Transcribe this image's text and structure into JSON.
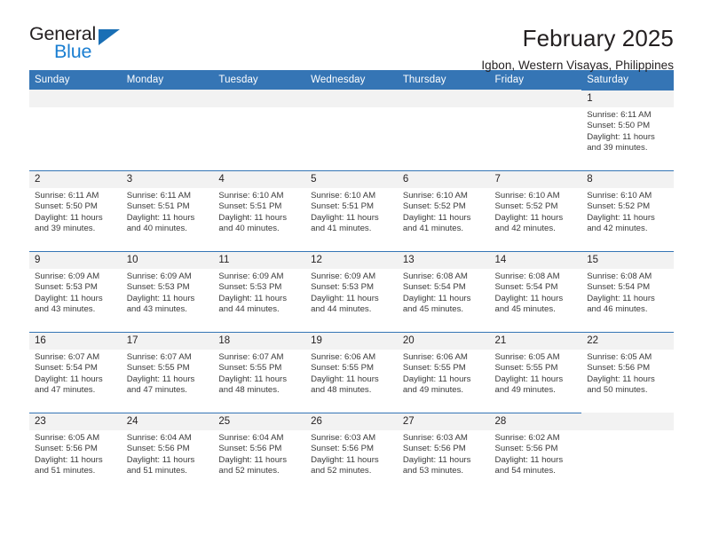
{
  "brand": {
    "name_top": "General",
    "name_bottom": "Blue",
    "accent_color": "#1a7ed1",
    "triangle_color": "#1a6fb5"
  },
  "header": {
    "title": "February 2025",
    "subtitle": "Igbon, Western Visayas, Philippines"
  },
  "theme": {
    "header_row_bg": "#3575b5",
    "daynum_bg": "#f2f2f2",
    "daynum_rule": "#3575b5",
    "text": "#231f20"
  },
  "weekdays": [
    "Sunday",
    "Monday",
    "Tuesday",
    "Wednesday",
    "Thursday",
    "Friday",
    "Saturday"
  ],
  "labels": {
    "sunrise_prefix": "Sunrise:",
    "sunset_prefix": "Sunset:",
    "daylight_prefix": "Daylight:"
  },
  "weeks": [
    [
      {
        "blank": true
      },
      {
        "blank": true
      },
      {
        "blank": true
      },
      {
        "blank": true
      },
      {
        "blank": true
      },
      {
        "blank": true
      },
      {
        "day": "1",
        "sunrise": "Sunrise: 6:11 AM",
        "sunset": "Sunset: 5:50 PM",
        "daylight": "Daylight: 11 hours and 39 minutes."
      }
    ],
    [
      {
        "day": "2",
        "sunrise": "Sunrise: 6:11 AM",
        "sunset": "Sunset: 5:50 PM",
        "daylight": "Daylight: 11 hours and 39 minutes."
      },
      {
        "day": "3",
        "sunrise": "Sunrise: 6:11 AM",
        "sunset": "Sunset: 5:51 PM",
        "daylight": "Daylight: 11 hours and 40 minutes."
      },
      {
        "day": "4",
        "sunrise": "Sunrise: 6:10 AM",
        "sunset": "Sunset: 5:51 PM",
        "daylight": "Daylight: 11 hours and 40 minutes."
      },
      {
        "day": "5",
        "sunrise": "Sunrise: 6:10 AM",
        "sunset": "Sunset: 5:51 PM",
        "daylight": "Daylight: 11 hours and 41 minutes."
      },
      {
        "day": "6",
        "sunrise": "Sunrise: 6:10 AM",
        "sunset": "Sunset: 5:52 PM",
        "daylight": "Daylight: 11 hours and 41 minutes."
      },
      {
        "day": "7",
        "sunrise": "Sunrise: 6:10 AM",
        "sunset": "Sunset: 5:52 PM",
        "daylight": "Daylight: 11 hours and 42 minutes."
      },
      {
        "day": "8",
        "sunrise": "Sunrise: 6:10 AM",
        "sunset": "Sunset: 5:52 PM",
        "daylight": "Daylight: 11 hours and 42 minutes."
      }
    ],
    [
      {
        "day": "9",
        "sunrise": "Sunrise: 6:09 AM",
        "sunset": "Sunset: 5:53 PM",
        "daylight": "Daylight: 11 hours and 43 minutes."
      },
      {
        "day": "10",
        "sunrise": "Sunrise: 6:09 AM",
        "sunset": "Sunset: 5:53 PM",
        "daylight": "Daylight: 11 hours and 43 minutes."
      },
      {
        "day": "11",
        "sunrise": "Sunrise: 6:09 AM",
        "sunset": "Sunset: 5:53 PM",
        "daylight": "Daylight: 11 hours and 44 minutes."
      },
      {
        "day": "12",
        "sunrise": "Sunrise: 6:09 AM",
        "sunset": "Sunset: 5:53 PM",
        "daylight": "Daylight: 11 hours and 44 minutes."
      },
      {
        "day": "13",
        "sunrise": "Sunrise: 6:08 AM",
        "sunset": "Sunset: 5:54 PM",
        "daylight": "Daylight: 11 hours and 45 minutes."
      },
      {
        "day": "14",
        "sunrise": "Sunrise: 6:08 AM",
        "sunset": "Sunset: 5:54 PM",
        "daylight": "Daylight: 11 hours and 45 minutes."
      },
      {
        "day": "15",
        "sunrise": "Sunrise: 6:08 AM",
        "sunset": "Sunset: 5:54 PM",
        "daylight": "Daylight: 11 hours and 46 minutes."
      }
    ],
    [
      {
        "day": "16",
        "sunrise": "Sunrise: 6:07 AM",
        "sunset": "Sunset: 5:54 PM",
        "daylight": "Daylight: 11 hours and 47 minutes."
      },
      {
        "day": "17",
        "sunrise": "Sunrise: 6:07 AM",
        "sunset": "Sunset: 5:55 PM",
        "daylight": "Daylight: 11 hours and 47 minutes."
      },
      {
        "day": "18",
        "sunrise": "Sunrise: 6:07 AM",
        "sunset": "Sunset: 5:55 PM",
        "daylight": "Daylight: 11 hours and 48 minutes."
      },
      {
        "day": "19",
        "sunrise": "Sunrise: 6:06 AM",
        "sunset": "Sunset: 5:55 PM",
        "daylight": "Daylight: 11 hours and 48 minutes."
      },
      {
        "day": "20",
        "sunrise": "Sunrise: 6:06 AM",
        "sunset": "Sunset: 5:55 PM",
        "daylight": "Daylight: 11 hours and 49 minutes."
      },
      {
        "day": "21",
        "sunrise": "Sunrise: 6:05 AM",
        "sunset": "Sunset: 5:55 PM",
        "daylight": "Daylight: 11 hours and 49 minutes."
      },
      {
        "day": "22",
        "sunrise": "Sunrise: 6:05 AM",
        "sunset": "Sunset: 5:56 PM",
        "daylight": "Daylight: 11 hours and 50 minutes."
      }
    ],
    [
      {
        "day": "23",
        "sunrise": "Sunrise: 6:05 AM",
        "sunset": "Sunset: 5:56 PM",
        "daylight": "Daylight: 11 hours and 51 minutes."
      },
      {
        "day": "24",
        "sunrise": "Sunrise: 6:04 AM",
        "sunset": "Sunset: 5:56 PM",
        "daylight": "Daylight: 11 hours and 51 minutes."
      },
      {
        "day": "25",
        "sunrise": "Sunrise: 6:04 AM",
        "sunset": "Sunset: 5:56 PM",
        "daylight": "Daylight: 11 hours and 52 minutes."
      },
      {
        "day": "26",
        "sunrise": "Sunrise: 6:03 AM",
        "sunset": "Sunset: 5:56 PM",
        "daylight": "Daylight: 11 hours and 52 minutes."
      },
      {
        "day": "27",
        "sunrise": "Sunrise: 6:03 AM",
        "sunset": "Sunset: 5:56 PM",
        "daylight": "Daylight: 11 hours and 53 minutes."
      },
      {
        "day": "28",
        "sunrise": "Sunrise: 6:02 AM",
        "sunset": "Sunset: 5:56 PM",
        "daylight": "Daylight: 11 hours and 54 minutes."
      },
      {
        "blank": true
      }
    ]
  ]
}
